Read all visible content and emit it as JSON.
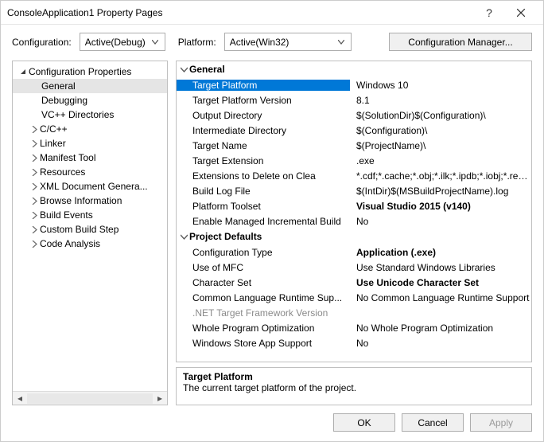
{
  "window": {
    "title": "ConsoleApplication1 Property Pages"
  },
  "toolbar": {
    "configuration_label": "Configuration:",
    "configuration_value": "Active(Debug)",
    "platform_label": "Platform:",
    "platform_value": "Active(Win32)",
    "config_manager_label": "Configuration Manager..."
  },
  "tree": {
    "root": "Configuration Properties",
    "items": [
      {
        "label": "General",
        "leaf": true,
        "selected": true
      },
      {
        "label": "Debugging",
        "leaf": true
      },
      {
        "label": "VC++ Directories",
        "leaf": true
      },
      {
        "label": "C/C++",
        "leaf": false
      },
      {
        "label": "Linker",
        "leaf": false
      },
      {
        "label": "Manifest Tool",
        "leaf": false
      },
      {
        "label": "Resources",
        "leaf": false
      },
      {
        "label": "XML Document Genera...",
        "leaf": false
      },
      {
        "label": "Browse Information",
        "leaf": false
      },
      {
        "label": "Build Events",
        "leaf": false
      },
      {
        "label": "Custom Build Step",
        "leaf": false
      },
      {
        "label": "Code Analysis",
        "leaf": false
      }
    ]
  },
  "categories": [
    {
      "name": "General",
      "props": [
        {
          "name": "Target Platform",
          "value": "Windows 10",
          "selected": true
        },
        {
          "name": "Target Platform Version",
          "value": "8.1"
        },
        {
          "name": "Output Directory",
          "value": "$(SolutionDir)$(Configuration)\\"
        },
        {
          "name": "Intermediate Directory",
          "value": "$(Configuration)\\"
        },
        {
          "name": "Target Name",
          "value": "$(ProjectName)\\"
        },
        {
          "name": "Target Extension",
          "value": ".exe"
        },
        {
          "name": "Extensions to Delete on Clea",
          "value": "*.cdf;*.cache;*.obj;*.ilk;*.ipdb;*.iobj;*.resou..."
        },
        {
          "name": "Build Log File",
          "value": "$(IntDir)$(MSBuildProjectName).log"
        },
        {
          "name": "Platform Toolset",
          "value": "Visual Studio 2015 (v140)",
          "bold": true
        },
        {
          "name": "Enable Managed Incremental Build",
          "value": "No"
        }
      ]
    },
    {
      "name": "Project Defaults",
      "props": [
        {
          "name": "Configuration Type",
          "value": "Application (.exe)",
          "bold": true
        },
        {
          "name": "Use of MFC",
          "value": "Use Standard Windows Libraries"
        },
        {
          "name": "Character Set",
          "value": "Use Unicode Character Set",
          "bold": true
        },
        {
          "name": "Common Language Runtime Sup...",
          "value": "No Common Language Runtime Support"
        },
        {
          "name": ".NET Target Framework Version",
          "value": "",
          "disabled": true
        },
        {
          "name": "Whole Program Optimization",
          "value": "No Whole Program Optimization"
        },
        {
          "name": "Windows Store App Support",
          "value": "No"
        }
      ]
    }
  ],
  "description": {
    "title": "Target Platform",
    "body": "The current target platform of the project."
  },
  "footer": {
    "ok": "OK",
    "cancel": "Cancel",
    "apply": "Apply"
  }
}
